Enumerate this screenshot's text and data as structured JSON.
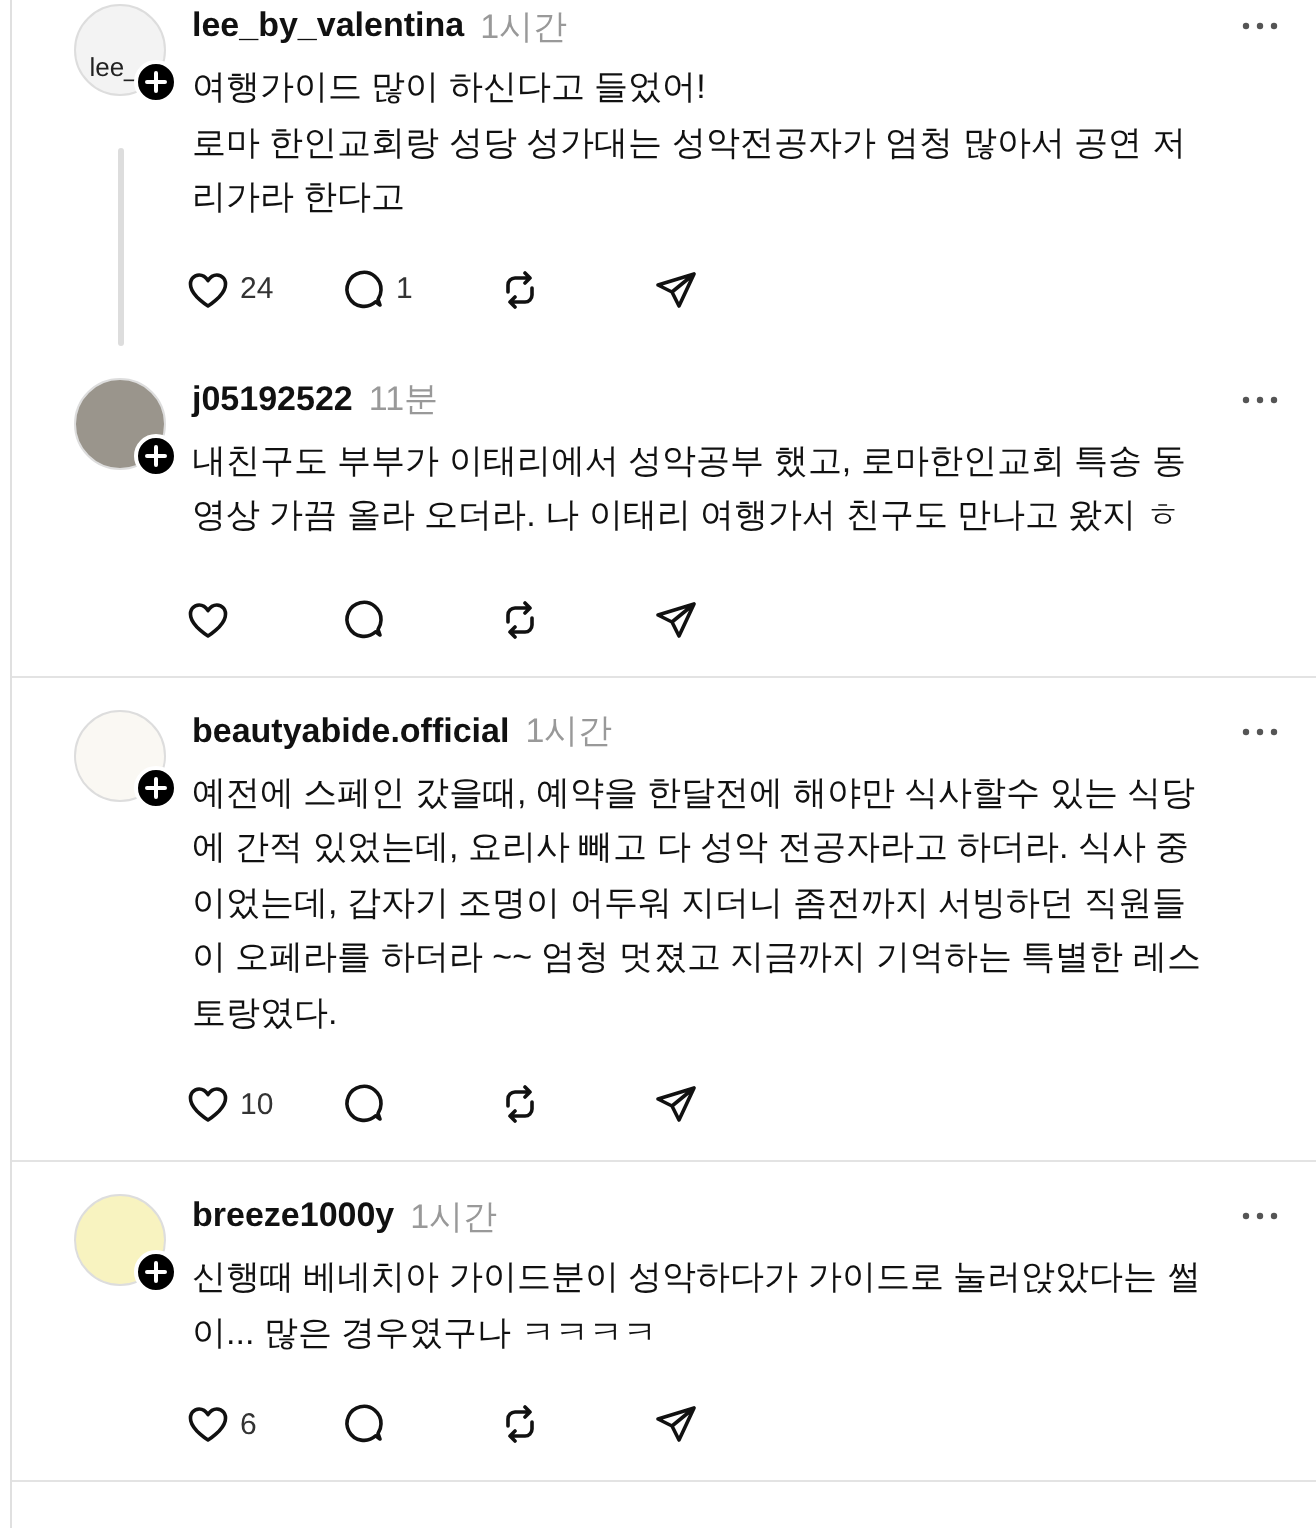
{
  "posts": [
    {
      "username": "lee_by_valentina",
      "time": "1시간",
      "avatar": {
        "kind": "broken",
        "alt": "lee_"
      },
      "text": "여행가이드 많이 하신다고 들었어!\n로마 한인교회랑 성당 성가대는 성악전공자가 엄청 많아서 공연 저리가라 한다고",
      "likes": "24",
      "replies": "1",
      "thread_continues": true
    },
    {
      "username": "j05192522",
      "time": "11분",
      "avatar": {
        "kind": "photo"
      },
      "text": "내친구도 부부가 이태리에서 성악공부 했고, 로마한인교회 특송 동영상 가끔 올라 오더라. 나 이태리 여행가서 친구도 만나고 왔지 ㅎ",
      "thread_continues": false
    },
    {
      "username": "beautyabide.official",
      "time": "1시간",
      "avatar": {
        "kind": "logo"
      },
      "text": "예전에 스페인 갔을때, 예약을 한달전에 해야만 식사할수 있는 식당에 간적 있었는데, 요리사 빼고 다 성악 전공자라고 하더라. 식사 중이었는데, 갑자기 조명이 어두워 지더니 좀전까지 서빙하던 직원들이 오페라를 하더라 ~~ 엄청 멋졌고 지금까지 기억하는 특별한 레스토랑였다.",
      "likes": "10",
      "thread_continues": false
    },
    {
      "username": "breeze1000y",
      "time": "1시간",
      "avatar": {
        "kind": "illustration"
      },
      "text": "신행때 베네치아 가이드분이 성악하다가 가이드로 눌러앉았다는 썰이... 많은 경우였구나 ㅋㅋㅋㅋ",
      "likes": "6",
      "thread_continues": false
    }
  ]
}
